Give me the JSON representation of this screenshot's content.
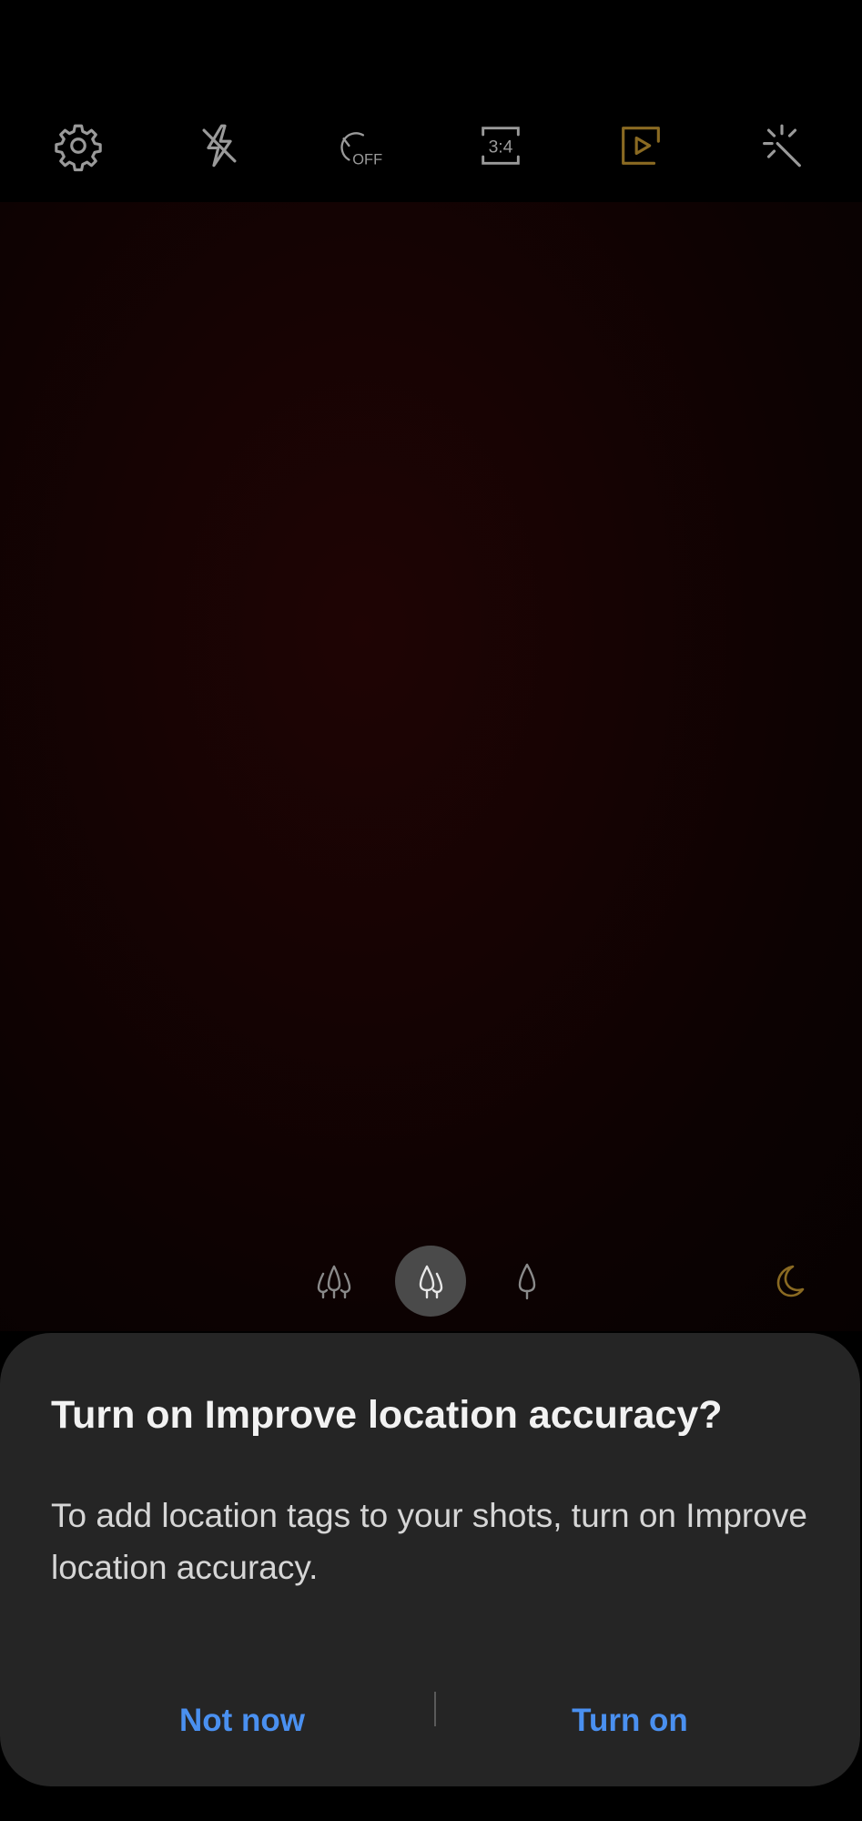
{
  "top_bar": {
    "icons": [
      {
        "name": "settings-icon",
        "label": ""
      },
      {
        "name": "flash-off-icon",
        "label": ""
      },
      {
        "name": "timer-off-icon",
        "label": "OFF"
      },
      {
        "name": "aspect-ratio-icon",
        "label": "3:4"
      },
      {
        "name": "motion-photo-icon",
        "label": ""
      },
      {
        "name": "filters-icon",
        "label": ""
      }
    ]
  },
  "zoom": {
    "options": [
      "ultra-wide-icon",
      "wide-icon",
      "tele-icon"
    ],
    "selected": 1
  },
  "night_mode": {
    "icon": "moon-icon"
  },
  "dialog": {
    "title": "Turn on Improve location accuracy?",
    "message": "To add location tags to your shots, turn on Improve location accuracy.",
    "negative_label": "Not now",
    "positive_label": "Turn on"
  },
  "colors": {
    "accent_gold": "#8a6a22",
    "icon_gray": "#9a9a9a",
    "button_blue": "#4a90f0",
    "dialog_bg": "#252525"
  }
}
